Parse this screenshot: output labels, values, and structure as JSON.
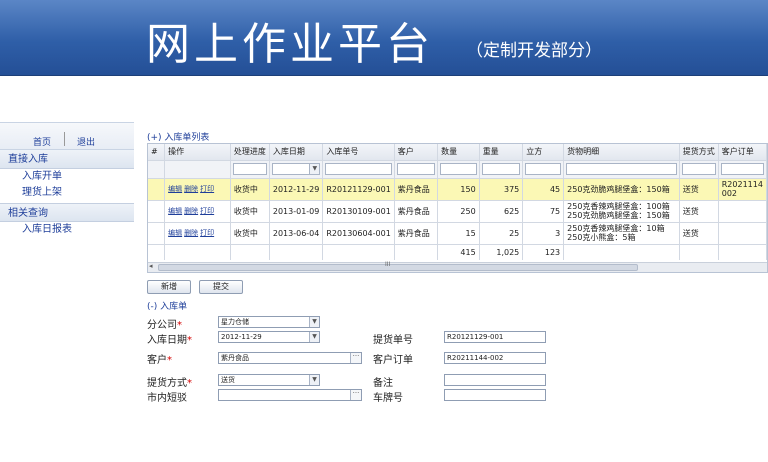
{
  "header": {
    "title": "网上作业平台",
    "subtitle": "（定制开发部分）"
  },
  "sidebar": {
    "home": "首页",
    "logout": "退出",
    "groups": [
      {
        "title": "直接入库",
        "items": [
          "入库开单",
          "理货上架"
        ]
      },
      {
        "title": "相关查询",
        "items": [
          "入库日报表"
        ]
      }
    ]
  },
  "grid": {
    "title": "(+) 入库单列表",
    "columns": [
      "#",
      "操作",
      "处理进度",
      "入库日期",
      "入库单号",
      "客户",
      "数量",
      "重量",
      "立方",
      "货物明细",
      "提货方式",
      "客户订单"
    ],
    "row_actions": [
      "编辑",
      "删除",
      "打印"
    ],
    "rows": [
      {
        "progress": "收货中",
        "date": "2012-11-29",
        "order_no": "R20121129-001",
        "customer": "紫丹食品",
        "qty": "150",
        "weight": "375",
        "volume": "45",
        "goods": [
          "250克劲脆鸡腿堡盒：150箱"
        ],
        "delivery": "送货",
        "customer_order": "R2021114\n002"
      },
      {
        "progress": "收货中",
        "date": "2013-01-09",
        "order_no": "R20130109-001",
        "customer": "紫丹食品",
        "qty": "250",
        "weight": "625",
        "volume": "75",
        "goods": [
          "250克香辣鸡腿堡盒：100箱",
          "250克劲脆鸡腿堡盒：150箱"
        ],
        "delivery": "送货",
        "customer_order": ""
      },
      {
        "progress": "收货中",
        "date": "2013-06-04",
        "order_no": "R20130604-001",
        "customer": "紫丹食品",
        "qty": "15",
        "weight": "25",
        "volume": "3",
        "goods": [
          "250克香辣鸡腿堡盒：10箱",
          "250克小熊盒：5箱"
        ],
        "delivery": "送货",
        "customer_order": ""
      }
    ],
    "totals": {
      "qty": "415",
      "weight": "1,025",
      "volume": "123"
    },
    "scroll_grip": "III",
    "scroll_arrow": "◂"
  },
  "toolbar": {
    "add_label": "新增",
    "submit_label": "提交"
  },
  "form": {
    "title": "(-) 入库单",
    "branch_label": "分公司",
    "branch_value": "星力仓储",
    "date_label": "入库日期",
    "date_value": "2012-11-29",
    "pickup_no_label": "提货单号",
    "pickup_no_value": "R20121129-001",
    "customer_label": "客户",
    "customer_value": "紫丹食品",
    "customer_order_label": "客户订单",
    "customer_order_value": "R20211144-002",
    "delivery_label": "提货方式",
    "delivery_value": "送货",
    "remark_label": "备注",
    "remark_value": "",
    "local_transfer_label": "市内短驳",
    "local_transfer_value": "",
    "plate_label": "车牌号",
    "plate_value": "",
    "required_mark": "*"
  }
}
